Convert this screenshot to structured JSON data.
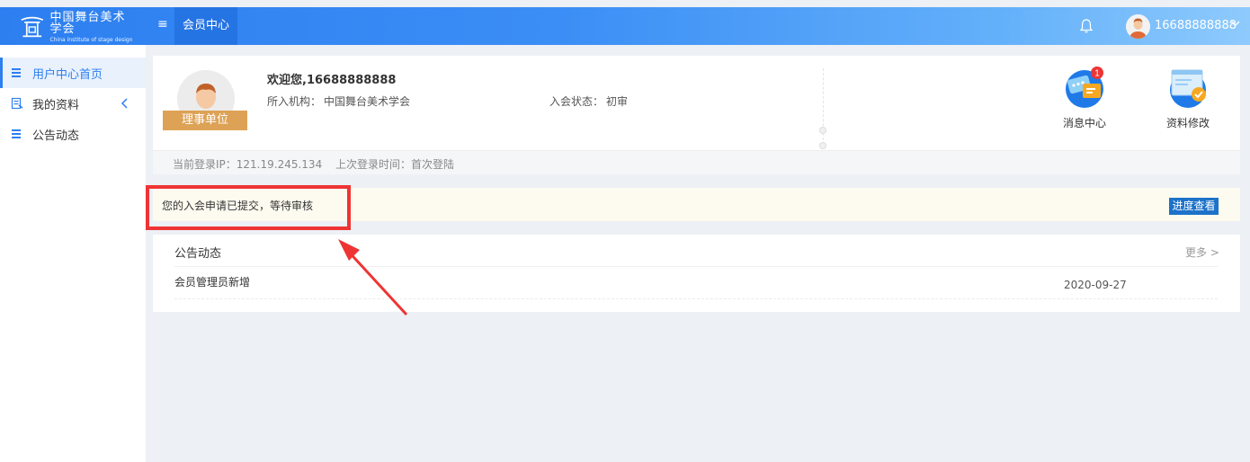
{
  "header": {
    "logo_cn": "中国舞台美术学会",
    "logo_en": "China institute of stage design",
    "nav_tab": "会员中心",
    "username": "16688888888"
  },
  "sidebar": {
    "items": [
      {
        "label": "用户中心首页",
        "icon": "list-icon",
        "active": true
      },
      {
        "label": "我的资料",
        "icon": "document-icon",
        "active": false
      },
      {
        "label": "公告动态",
        "icon": "list-icon",
        "active": false
      }
    ]
  },
  "profile": {
    "role_badge": "理事单位",
    "welcome": "欢迎您,16688888888",
    "institution_label": "所入机构：",
    "institution_value": "中国舞台美术学会",
    "status_label": "入会状态：",
    "status_value": "初审",
    "ip_text": "当前登录IP：121.19.245.134",
    "last_login_text": "上次登录时间：首次登陆"
  },
  "quick_links": [
    {
      "label": "消息中心",
      "icon": "message-center-icon",
      "badge": "1"
    },
    {
      "label": "资料修改",
      "icon": "profile-edit-icon"
    }
  ],
  "notice": {
    "text": "您的入会申请已提交，等待审核",
    "button": "进度查看"
  },
  "announcements": {
    "title": "公告动态",
    "more": "更多 >",
    "items": [
      {
        "title": "会员管理员新增",
        "date": "2020-09-27"
      }
    ]
  },
  "colors": {
    "header_start": "#2d7ff0",
    "header_end": "#8ecafc",
    "accent": "#2d7ff0",
    "badge_gold": "#dda256",
    "button_blue": "#1d72c9",
    "highlight_red": "#ee3434"
  }
}
